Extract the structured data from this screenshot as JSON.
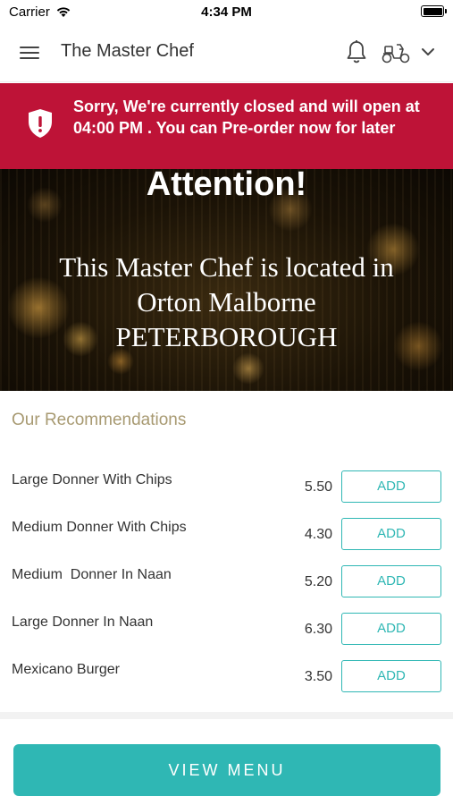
{
  "status_bar": {
    "carrier": "Carrier",
    "time": "4:34 PM"
  },
  "header": {
    "title": "The Master Chef"
  },
  "alert": {
    "message": "Sorry, We're currently closed and will open at 04:00 PM . You can Pre-order now for later"
  },
  "banner": {
    "heading": "Attention!",
    "lines": [
      "This Master Chef is located in",
      "Orton Malborne",
      "PETERBOROUGH"
    ]
  },
  "recommendations": {
    "title": "Our Recommendations",
    "items": [
      {
        "name": "Large Donner With Chips",
        "price": "5.50",
        "button": "ADD"
      },
      {
        "name": "Medium Donner With Chips",
        "price": "4.30",
        "button": "ADD"
      },
      {
        "name": "Medium  Donner In Naan",
        "price": "5.20",
        "button": "ADD"
      },
      {
        "name": "Large Donner In Naan",
        "price": "6.30",
        "button": "ADD"
      },
      {
        "name": "Mexicano Burger",
        "price": "3.50",
        "button": "ADD"
      }
    ]
  },
  "footer": {
    "view_menu_label": "VIEW MENU"
  },
  "colors": {
    "accent": "#2fb7b4",
    "alert": "#be1337",
    "section_title": "#a89a72"
  },
  "icons": [
    "menu-icon",
    "bell-icon",
    "moped-icon",
    "chevron-down-icon",
    "shield-alert-icon",
    "wifi-icon",
    "battery-icon"
  ]
}
